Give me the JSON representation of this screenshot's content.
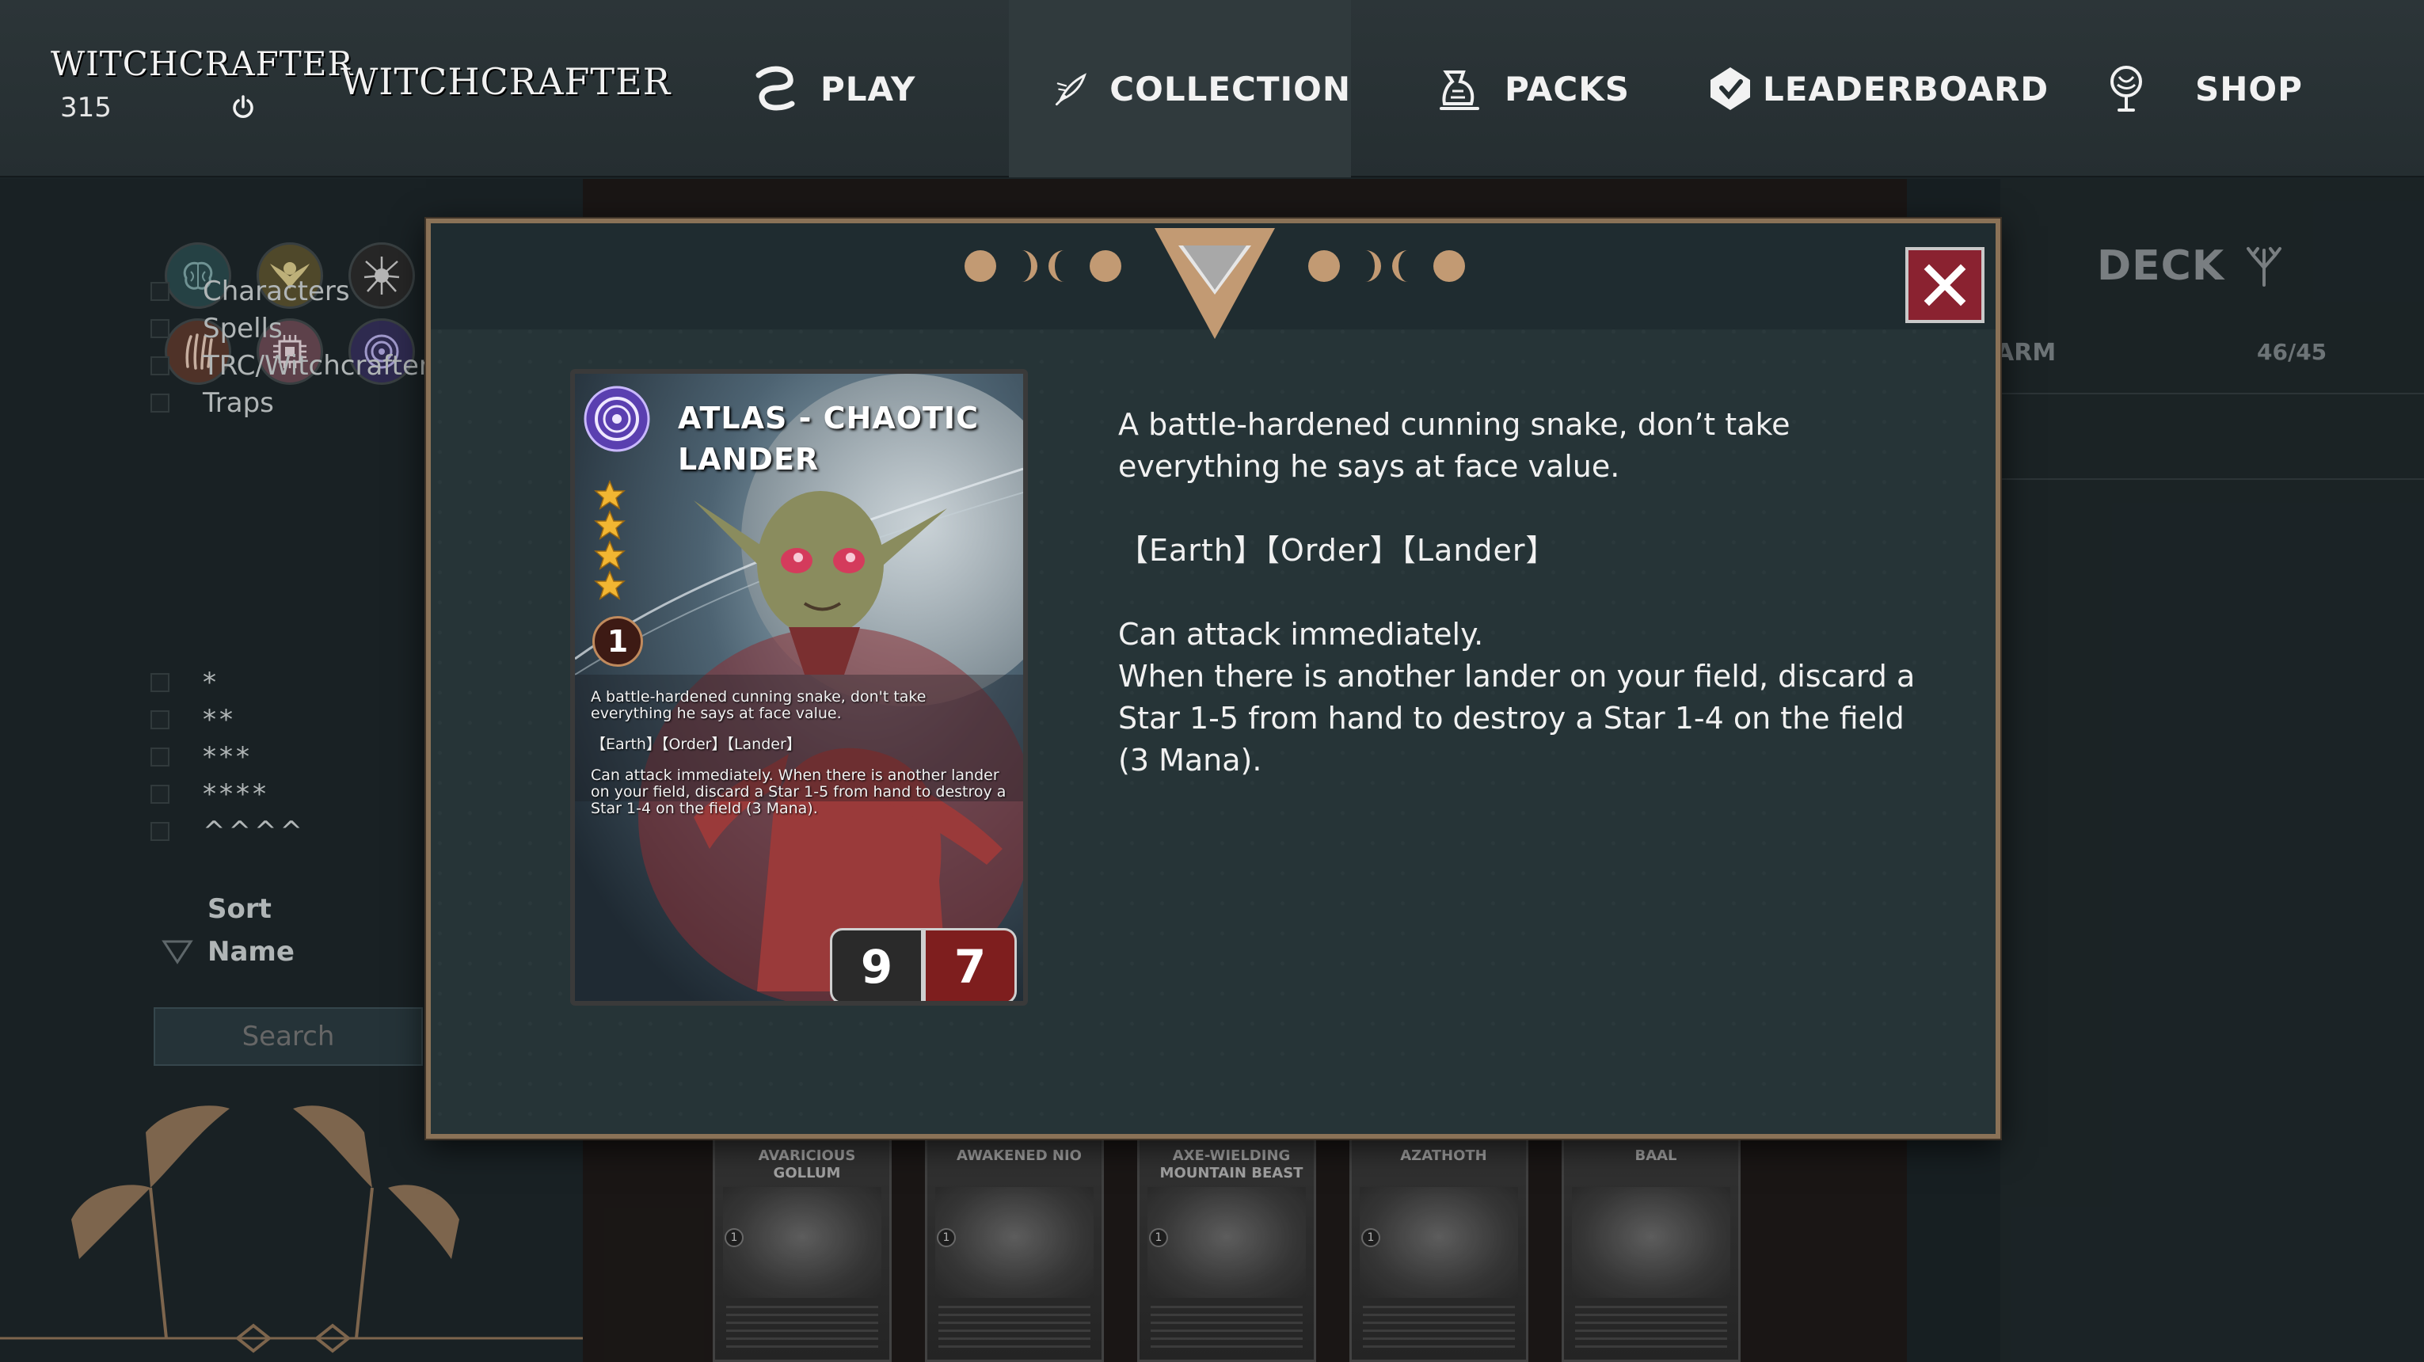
{
  "header": {
    "mini_logo": "WITCHCRAFTER",
    "points": "315",
    "brand": "WITCHCRAFTER",
    "nav": [
      {
        "label": "PLAY",
        "icon": "play-swirl-icon"
      },
      {
        "label": "COLLECTION",
        "icon": "collection-quill-icon"
      },
      {
        "label": "PACKS",
        "icon": "packs-bag-icon"
      },
      {
        "label": "LEADERBOARD",
        "icon": "leaderboard-badge-icon"
      },
      {
        "label": "SHOP",
        "icon": "shop-tree-icon"
      }
    ],
    "active": "COLLECTION"
  },
  "sidebar": {
    "element_filters": [
      "brain-element-icon",
      "winged-sun-element-icon",
      "spider-element-icon",
      "claw-element-icon",
      "chip-element-icon",
      "orbit-element-icon"
    ],
    "type_filters": [
      "Characters",
      "Spells",
      "TRC/Witchcrafters",
      "Traps"
    ],
    "star_filters": [
      "*",
      "**",
      "***",
      "****",
      "^^^^"
    ],
    "sort_label": "Sort",
    "sort_value": "Name",
    "search_placeholder": "Search"
  },
  "deck": {
    "title": "DECK",
    "subtitle": "ARM",
    "count": "46/45"
  },
  "bottom_cards": [
    {
      "name": "AVARICIOUS GOLLUM",
      "cost": "1"
    },
    {
      "name": "AWAKENED NIO",
      "cost": "1"
    },
    {
      "name": "AXE-WIELDING MOUNTAIN BEAST",
      "cost": "1"
    },
    {
      "name": "AZATHOTH",
      "cost": "1"
    },
    {
      "name": "BAAL",
      "cost": ""
    }
  ],
  "modal": {
    "card": {
      "title": "ATLAS - CHAOTIC LANDER",
      "stars": 4,
      "cost": "1",
      "flavor": "A battle-hardened cunning snake, don't take everything he says at face value.",
      "tags": "【Earth】【Order】【Lander】",
      "ability": "Can attack immediately. When there is another lander on your field, discard a Star 1-5 from hand to destroy a Star 1-4 on the field (3 Mana).",
      "attack": "9",
      "defense": "7"
    },
    "description": {
      "flavor": "A battle-hardened cunning snake, don’t take everything he says at face value.",
      "tags": "【Earth】【Order】【Lander】",
      "ability_line1": "Can attack immediately.",
      "ability_line2": "When there is another lander on your field, discard a Star 1-5 from hand to destroy a Star 1-4 on the field (3 Mana)."
    }
  },
  "colors": {
    "modal_border": "#8a7257",
    "close_button": "#8a2230",
    "defense_stat": "#7e1e1e",
    "star": "#f2b632"
  }
}
